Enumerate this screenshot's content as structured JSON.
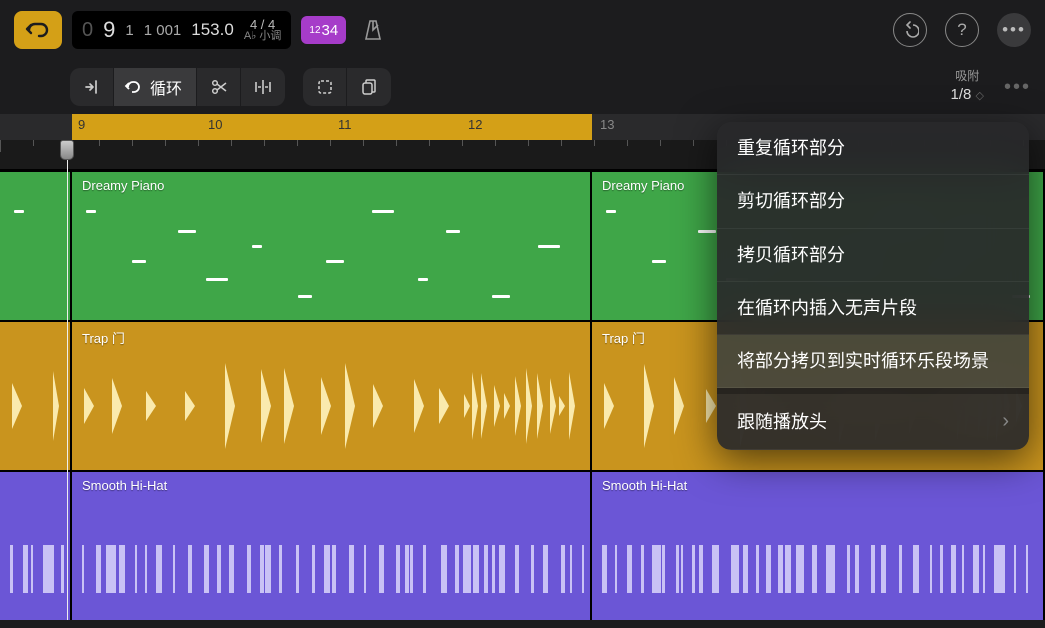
{
  "transport": {
    "position_bar": "9",
    "position_beat": "1",
    "position_sub": "1 001",
    "tempo": "153.0",
    "time_sig": "4 / 4",
    "key": "A♭ 小调",
    "count_in": "1234"
  },
  "toolbar": {
    "loop_label": "循环",
    "snap_label": "吸附",
    "snap_value": "1/8"
  },
  "ruler": {
    "bars": [
      "9",
      "10",
      "11",
      "12",
      "13"
    ]
  },
  "tracks": [
    {
      "name": "Dreamy Piano",
      "color": "green"
    },
    {
      "name": "Trap 门",
      "color": "yellow"
    },
    {
      "name": "Smooth Hi-Hat",
      "color": "purple"
    }
  ],
  "context_menu": {
    "items": [
      "重复循环部分",
      "剪切循环部分",
      "拷贝循环部分",
      "在循环内插入无声片段",
      "将部分拷贝到实时循环乐段场景",
      "跟随播放头"
    ]
  }
}
